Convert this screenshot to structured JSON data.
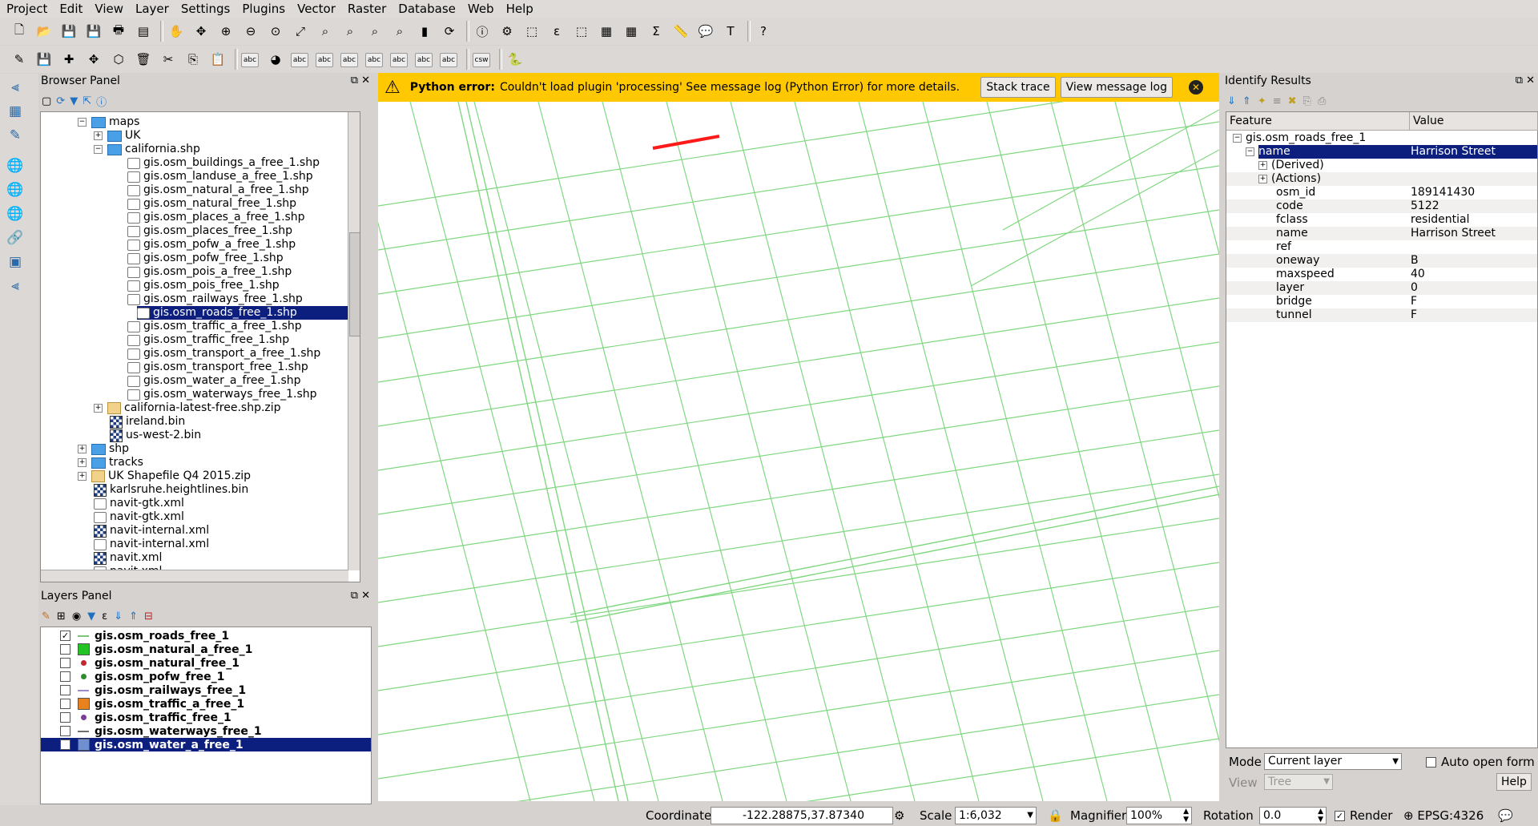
{
  "menubar": [
    "Project",
    "Edit",
    "View",
    "Layer",
    "Settings",
    "Plugins",
    "Vector",
    "Raster",
    "Database",
    "Web",
    "Help"
  ],
  "browser": {
    "title": "Browser Panel",
    "items": [
      {
        "label": "maps",
        "indent": 0,
        "type": "folder",
        "exp": "−"
      },
      {
        "label": "UK",
        "indent": 1,
        "type": "folder",
        "exp": "+"
      },
      {
        "label": "california.shp",
        "indent": 1,
        "type": "folder",
        "exp": "−"
      },
      {
        "label": "gis.osm_buildings_a_free_1.shp",
        "indent": 2,
        "type": "file"
      },
      {
        "label": "gis.osm_landuse_a_free_1.shp",
        "indent": 2,
        "type": "file"
      },
      {
        "label": "gis.osm_natural_a_free_1.shp",
        "indent": 2,
        "type": "file"
      },
      {
        "label": "gis.osm_natural_free_1.shp",
        "indent": 2,
        "type": "file"
      },
      {
        "label": "gis.osm_places_a_free_1.shp",
        "indent": 2,
        "type": "file"
      },
      {
        "label": "gis.osm_places_free_1.shp",
        "indent": 2,
        "type": "file"
      },
      {
        "label": "gis.osm_pofw_a_free_1.shp",
        "indent": 2,
        "type": "file"
      },
      {
        "label": "gis.osm_pofw_free_1.shp",
        "indent": 2,
        "type": "file"
      },
      {
        "label": "gis.osm_pois_a_free_1.shp",
        "indent": 2,
        "type": "file"
      },
      {
        "label": "gis.osm_pois_free_1.shp",
        "indent": 2,
        "type": "file"
      },
      {
        "label": "gis.osm_railways_free_1.shp",
        "indent": 2,
        "type": "file"
      },
      {
        "label": "gis.osm_roads_free_1.shp",
        "indent": 2,
        "type": "file",
        "selected": true
      },
      {
        "label": "gis.osm_traffic_a_free_1.shp",
        "indent": 2,
        "type": "file"
      },
      {
        "label": "gis.osm_traffic_free_1.shp",
        "indent": 2,
        "type": "file"
      },
      {
        "label": "gis.osm_transport_a_free_1.shp",
        "indent": 2,
        "type": "file"
      },
      {
        "label": "gis.osm_transport_free_1.shp",
        "indent": 2,
        "type": "file"
      },
      {
        "label": "gis.osm_water_a_free_1.shp",
        "indent": 2,
        "type": "file"
      },
      {
        "label": "gis.osm_waterways_free_1.shp",
        "indent": 2,
        "type": "file"
      },
      {
        "label": "california-latest-free.shp.zip",
        "indent": 1,
        "type": "zip",
        "exp": "+"
      },
      {
        "label": "ireland.bin",
        "indent": 1,
        "type": "raster"
      },
      {
        "label": "us-west-2.bin",
        "indent": 1,
        "type": "raster"
      },
      {
        "label": "shp",
        "indent": 0,
        "type": "folder",
        "exp": "+"
      },
      {
        "label": "tracks",
        "indent": 0,
        "type": "folder",
        "exp": "+"
      },
      {
        "label": "UK Shapefile Q4 2015.zip",
        "indent": 0,
        "type": "zip",
        "exp": "+"
      },
      {
        "label": "karlsruhe.heightlines.bin",
        "indent": 0,
        "type": "raster"
      },
      {
        "label": "navit-gtk.xml",
        "indent": 0,
        "type": "file"
      },
      {
        "label": "navit-gtk.xml",
        "indent": 0,
        "type": "file"
      },
      {
        "label": "navit-internal.xml",
        "indent": 0,
        "type": "raster"
      },
      {
        "label": "navit-internal.xml",
        "indent": 0,
        "type": "file"
      },
      {
        "label": "navit.xml",
        "indent": 0,
        "type": "raster"
      },
      {
        "label": "navit.xml",
        "indent": 0,
        "type": "file"
      }
    ]
  },
  "layers": {
    "title": "Layers Panel",
    "items": [
      {
        "label": "gis.osm_roads_free_1",
        "checked": true,
        "symbol": "line",
        "color": "#7cc47c"
      },
      {
        "label": "gis.osm_natural_a_free_1",
        "checked": false,
        "symbol": "fill",
        "color": "#22c322"
      },
      {
        "label": "gis.osm_natural_free_1",
        "checked": false,
        "symbol": "point",
        "color": "#c0282e"
      },
      {
        "label": "gis.osm_pofw_free_1",
        "checked": false,
        "symbol": "point",
        "color": "#2e8c2e"
      },
      {
        "label": "gis.osm_railways_free_1",
        "checked": false,
        "symbol": "line",
        "color": "#a08ac8"
      },
      {
        "label": "gis.osm_traffic_a_free_1",
        "checked": false,
        "symbol": "fill",
        "color": "#e8821e"
      },
      {
        "label": "gis.osm_traffic_free_1",
        "checked": false,
        "symbol": "point",
        "color": "#7a3e9a"
      },
      {
        "label": "gis.osm_waterways_free_1",
        "checked": false,
        "symbol": "line",
        "color": "#6e6e6e"
      },
      {
        "label": "gis.osm_water_a_free_1",
        "checked": false,
        "symbol": "fill",
        "color": "#6f8fd0",
        "selected": true
      }
    ]
  },
  "message": {
    "title": "Python error:",
    "text": "Couldn't load plugin 'processing' See message log (Python Error) for more details.",
    "stack_trace": "Stack trace",
    "view_log": "View message log"
  },
  "identify": {
    "title": "Identify Results",
    "col_feature": "Feature",
    "col_value": "Value",
    "rows": [
      {
        "key": "gis.osm_roads_free_1",
        "value": "",
        "indent": 0,
        "exp": "−"
      },
      {
        "key": "name",
        "value": "Harrison Street",
        "indent": 1,
        "exp": "−",
        "selected": true
      },
      {
        "key": "(Derived)",
        "value": "",
        "indent": 2,
        "exp": "+"
      },
      {
        "key": "(Actions)",
        "value": "",
        "indent": 2,
        "exp": "+"
      },
      {
        "key": "osm_id",
        "value": "189141430",
        "indent": 2
      },
      {
        "key": "code",
        "value": "5122",
        "indent": 2
      },
      {
        "key": "fclass",
        "value": "residential",
        "indent": 2
      },
      {
        "key": "name",
        "value": "Harrison Street",
        "indent": 2
      },
      {
        "key": "ref",
        "value": "",
        "indent": 2
      },
      {
        "key": "oneway",
        "value": "B",
        "indent": 2
      },
      {
        "key": "maxspeed",
        "value": "40",
        "indent": 2
      },
      {
        "key": "layer",
        "value": "0",
        "indent": 2
      },
      {
        "key": "bridge",
        "value": "F",
        "indent": 2
      },
      {
        "key": "tunnel",
        "value": "F",
        "indent": 2
      }
    ],
    "mode_label": "Mode",
    "mode_value": "Current layer",
    "auto_open": "Auto open form",
    "view_label": "View",
    "view_value": "Tree",
    "help": "Help"
  },
  "status": {
    "coordinate_label": "Coordinate",
    "coordinate_value": "-122.28875,37.87340",
    "scale_label": "Scale",
    "scale_value": "1:6,032",
    "magnifier_label": "Magnifier",
    "magnifier_value": "100%",
    "rotation_label": "Rotation",
    "rotation_value": "0.0",
    "render_label": "Render",
    "epsg": "EPSG:4326"
  },
  "colors": {
    "road": "#7fd77f",
    "highlight": "#ff1a1a",
    "selection": "#0c1f7e",
    "warning": "#ffc800"
  }
}
